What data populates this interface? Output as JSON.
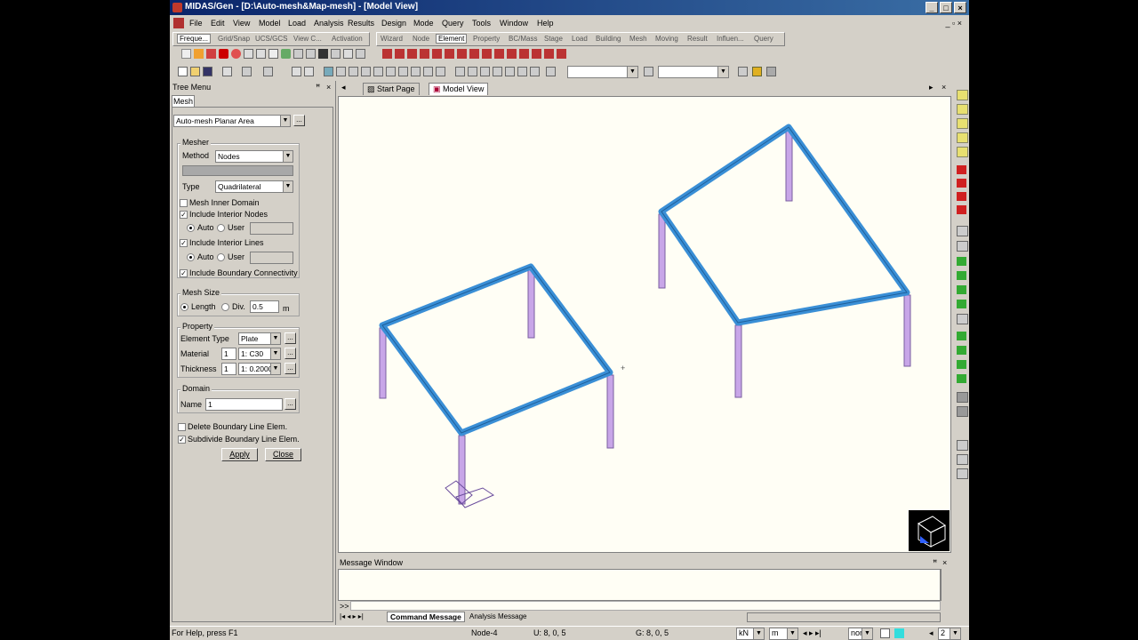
{
  "window": {
    "title": "MIDAS/Gen - [D:\\Auto-mesh&Map-mesh] - [Model View]"
  },
  "menu": [
    "File",
    "Edit",
    "View",
    "Model",
    "Load",
    "Analysis",
    "Results",
    "Design",
    "Mode",
    "Query",
    "Tools",
    "Window",
    "Help"
  ],
  "tabbar_left": [
    "Freque...",
    "Grid/Snap",
    "UCS/GCS",
    "View C...",
    "Activation"
  ],
  "tabbar_right": [
    "Wizard",
    "Node",
    "Element",
    "Property",
    "BC/Mass",
    "Stage",
    "Load",
    "Building",
    "Mesh",
    "Moving",
    "Result",
    "Influen...",
    "Query"
  ],
  "tree": {
    "title": "Tree Menu",
    "tab": "Mesh",
    "command": "Auto-mesh Planar Area",
    "mesher": {
      "group": "Mesher",
      "method_label": "Method",
      "method_value": "Nodes",
      "type_label": "Type",
      "type_value": "Quadrilateral",
      "mesh_inner": "Mesh Inner Domain",
      "include_nodes": "Include Interior Nodes",
      "include_lines": "Include Interior Lines",
      "auto": "Auto",
      "user": "User",
      "include_boundary": "Include Boundary Connectivity"
    },
    "mesh_size": {
      "group": "Mesh Size",
      "length": "Length",
      "div": "Div.",
      "value": "0.5",
      "unit": "m"
    },
    "property": {
      "group": "Property",
      "element_type_label": "Element Type",
      "element_type_value": "Plate",
      "material_label": "Material",
      "material_id": "1",
      "material_value": "1: C30",
      "thickness_label": "Thickness",
      "thickness_id": "1",
      "thickness_value": "1: 0.2000"
    },
    "domain": {
      "group": "Domain",
      "name_label": "Name",
      "name_value": "1"
    },
    "delete_boundary": "Delete Boundary Line Elem.",
    "subdivide_boundary": "Subdivide Boundary Line Elem.",
    "apply": "Apply",
    "close": "Close"
  },
  "view_tabs": [
    "Start Page",
    "Model View"
  ],
  "message": {
    "title": "Message Window",
    "prompt": ">>",
    "tabs": [
      "Command Message",
      "Analysis Message"
    ]
  },
  "status": {
    "help": "For Help, press F1",
    "node": "Node-4",
    "u": "U: 8, 0, 5",
    "g": "G: 8, 0, 5",
    "force_unit": "kN",
    "length_unit": "m",
    "snap": "non",
    "page": "2"
  },
  "colors": {
    "beam": "#3a8fd6",
    "column": "#c8a6e8",
    "canvas": "#fffef5",
    "title": "#0a246a"
  }
}
